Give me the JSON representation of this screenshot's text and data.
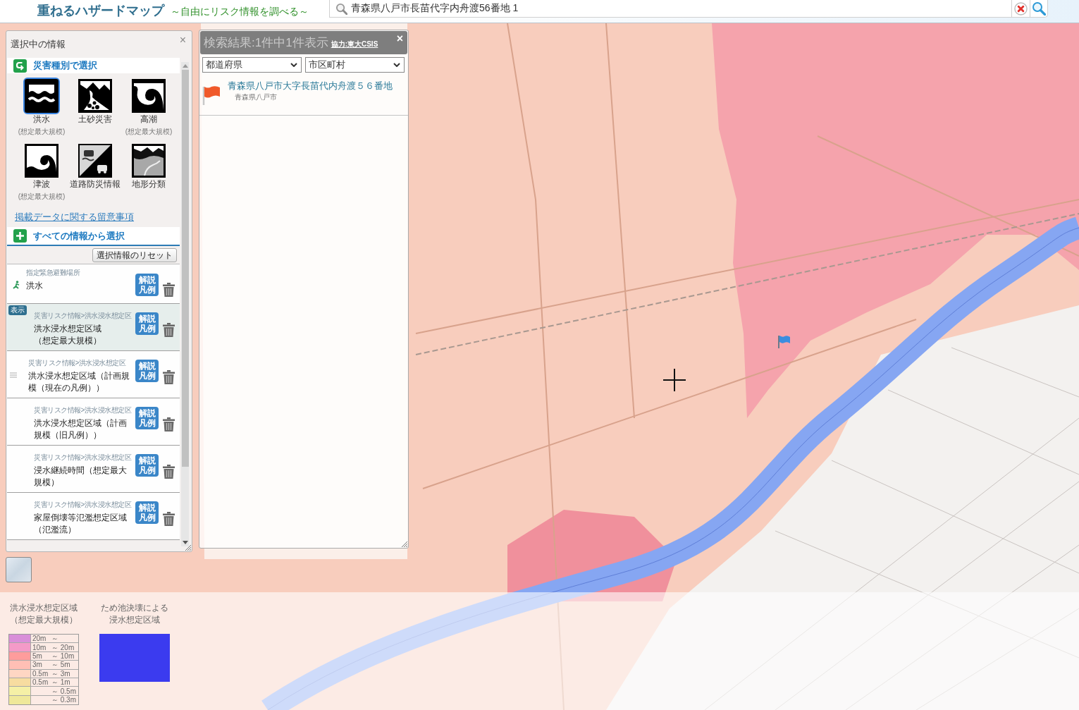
{
  "header": {
    "title": "重ねるハザードマップ",
    "subtitle": "～自由にリスク情報を調べる～",
    "search_field": {
      "value": "青森県八戸市長苗代字内舟渡56番地 1"
    }
  },
  "selection_panel": {
    "title": "選択中の情報",
    "close": "×",
    "hazard_section": "災害種別で選択",
    "hazards": [
      {
        "kind": "flood",
        "label": "洪水",
        "note": "(想定最大規模)",
        "selected": true
      },
      {
        "kind": "landslide",
        "label": "土砂災害",
        "selected": false
      },
      {
        "kind": "storm_surge",
        "label": "高潮",
        "note": "(想定最大規模)",
        "selected": false
      },
      {
        "kind": "tsunami",
        "label": "津波",
        "note": "(想定最大規模)",
        "selected": false
      },
      {
        "kind": "road",
        "label": "道路防災情報",
        "selected": false
      },
      {
        "kind": "landform",
        "label": "地形分類",
        "selected": false
      }
    ],
    "notice_link": "掲載データに関する留意事項",
    "all_section": "すべての情報から選択",
    "reset_button": "選択情報のリセット",
    "layers": [
      {
        "kind": "shelter",
        "category": "指定緊急避難場所",
        "name": "洪水",
        "button": "解説凡例",
        "selected": false,
        "hovered": false
      },
      {
        "kind": "layer",
        "badge": "表示",
        "category": "災害リスク情報>洪水浸水想定区",
        "name": [
          "洪水浸水想定区域",
          "（想定最大規模）"
        ],
        "button": "解説凡例",
        "selected": true,
        "hovered": false
      },
      {
        "kind": "layer",
        "category": "災害リスク情報>洪水浸水想定区",
        "name": "洪水浸水想定区域（計画規模（現在の凡例））",
        "button": "解説凡例",
        "selected": false,
        "hovered": true
      },
      {
        "kind": "layer",
        "category": "災害リスク情報>洪水浸水想定区",
        "name": "洪水浸水想定区域（計画規模（旧凡例））",
        "button": "解説凡例",
        "selected": false,
        "hovered": false
      },
      {
        "kind": "layer",
        "category": "災害リスク情報>洪水浸水想定区",
        "name": "浸水継続時間（想定最大規模）",
        "button": "解説凡例",
        "selected": false,
        "hovered": false
      },
      {
        "kind": "layer",
        "category": "災害リスク情報>洪水浸水想定区",
        "name": "家屋倒壊等氾濫想定区域（氾濫流）",
        "button": "解説凡例",
        "selected": false,
        "hovered": false
      }
    ]
  },
  "search_results": {
    "title": "検索結果:1件中1件表示",
    "credit": "協力:東大CSIS",
    "close": "×",
    "prefecture_select": {
      "value": "都道府県"
    },
    "city_select": {
      "value": "市区町村"
    },
    "results": [
      {
        "address": "青森県八戸市大字長苗代内舟渡５６番地",
        "area": "青森県八戸市"
      }
    ]
  },
  "legend": [
    {
      "kind": "depth_scale",
      "title": [
        "洪水浸水想定区域",
        "（想定最大規模）"
      ],
      "rows": [
        {
          "from": "20m",
          "to": "～",
          "color": "#d98fd9"
        },
        {
          "from": "10m",
          "to": "～ 20m",
          "color": "#f49ac8"
        },
        {
          "from": "5m",
          "to": "～ 10m",
          "color": "#ff9c9c"
        },
        {
          "from": "3m",
          "to": "～ 5m",
          "color": "#ffbfb5"
        },
        {
          "from": "0.5m",
          "to": "～ 3m",
          "color": "#ffd6c3"
        },
        {
          "from": "0.5m",
          "to": "～ 1m",
          "color": "#f7dca0"
        },
        {
          "to": "～ 0.5m",
          "color": "#f5f0a6"
        },
        {
          "to": "～ 0.3m",
          "color": "#efe89a"
        }
      ]
    },
    {
      "kind": "area",
      "title": [
        "ため池決壊による",
        "浸水想定区域"
      ],
      "color": "#3b3bef"
    }
  ]
}
